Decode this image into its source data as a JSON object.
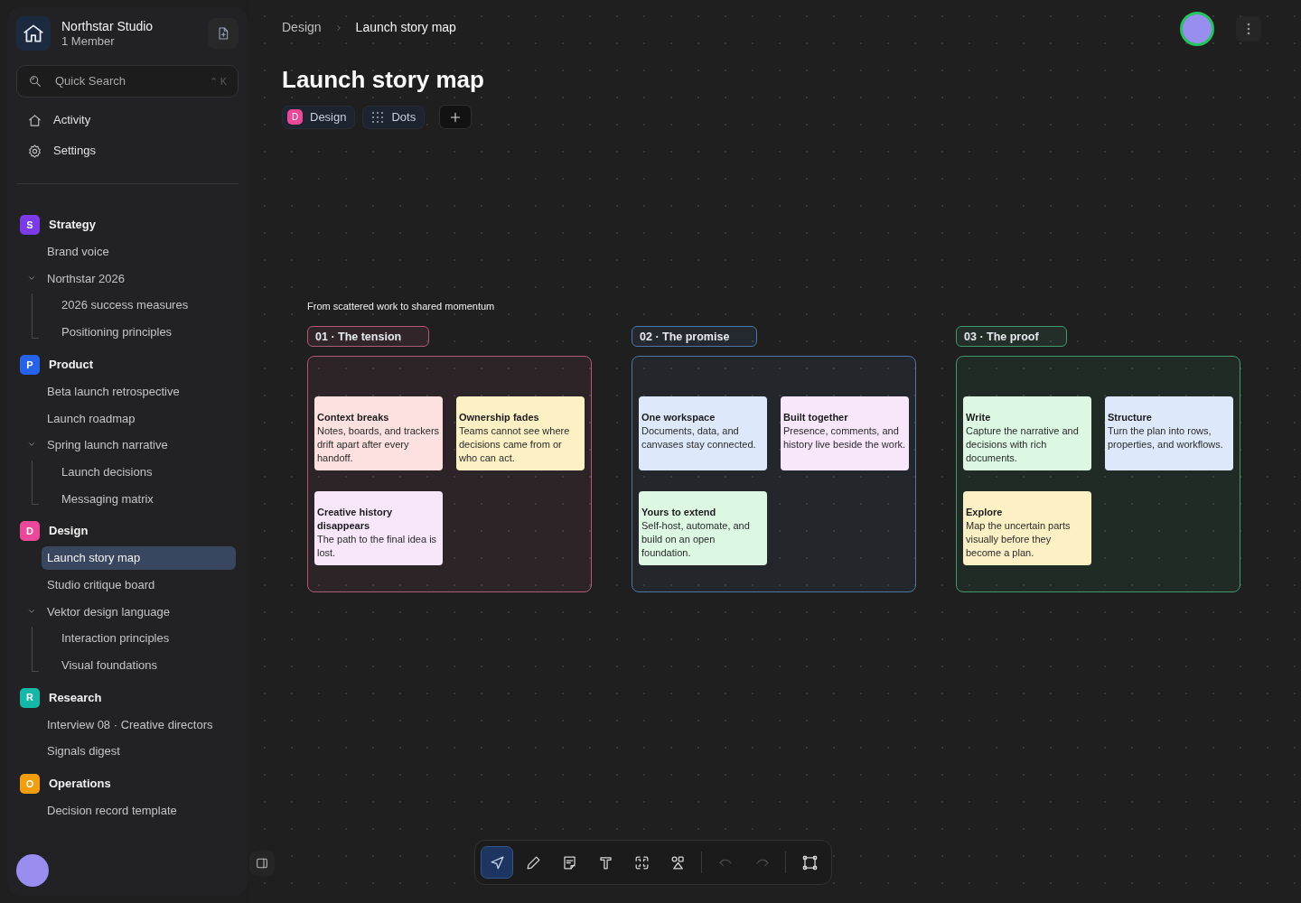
{
  "workspace": {
    "name": "Northstar Studio",
    "members": "1 Member"
  },
  "search": {
    "placeholder": "Quick Search",
    "shortcut": "⌃ K"
  },
  "nav": [
    {
      "kind": "activity",
      "label": "Activity"
    },
    {
      "kind": "settings",
      "label": "Settings"
    }
  ],
  "sections": [
    {
      "letter": "S",
      "name": "Strategy",
      "color": "#7c3aed",
      "items": [
        {
          "label": "Brand voice",
          "selected": false
        },
        {
          "label": "Northstar 2026",
          "selected": false,
          "expanded": true,
          "children": [
            {
              "label": "2026 success measures",
              "selected": false
            },
            {
              "label": "Positioning principles",
              "selected": false
            }
          ]
        }
      ]
    },
    {
      "letter": "P",
      "name": "Product",
      "color": "#2563eb",
      "items": [
        {
          "label": "Beta launch retrospective",
          "selected": false
        },
        {
          "label": "Launch roadmap",
          "selected": false
        },
        {
          "label": "Spring launch narrative",
          "selected": false,
          "expanded": true,
          "children": [
            {
              "label": "Launch decisions",
              "selected": false
            },
            {
              "label": "Messaging matrix",
              "selected": false
            }
          ]
        }
      ]
    },
    {
      "letter": "D",
      "name": "Design",
      "color": "#ec4899",
      "items": [
        {
          "label": "Launch story map",
          "selected": true
        },
        {
          "label": "Studio critique board",
          "selected": false
        },
        {
          "label": "Vektor design language",
          "selected": false,
          "expanded": true,
          "children": [
            {
              "label": "Interaction principles",
              "selected": false
            },
            {
              "label": "Visual foundations",
              "selected": false
            }
          ]
        }
      ]
    },
    {
      "letter": "R",
      "name": "Research",
      "color": "#14b8a6",
      "items": [
        {
          "label": "Interview 08 · Creative directors",
          "selected": false
        },
        {
          "label": "Signals digest",
          "selected": false
        }
      ]
    },
    {
      "letter": "O",
      "name": "Operations",
      "color": "#f59e0b",
      "items": [
        {
          "label": "Decision record template",
          "selected": false
        }
      ]
    }
  ],
  "breadcrumb": [
    "Design",
    "Launch story map"
  ],
  "page_title": "Launch story map",
  "tags": [
    {
      "kind": "space",
      "letter": "D",
      "label": "Design",
      "color": "#ec4899"
    },
    {
      "kind": "background",
      "label": "Dots"
    }
  ],
  "canvas": {
    "caption": "From scattered work to shared momentum",
    "frames": [
      {
        "label": "01 · The tension",
        "color": "#b05a7a",
        "notes": [
          {
            "title": "Context breaks",
            "text": "Notes, boards, and trackers drift apart after every handoff.",
            "color": "#fde0e0"
          },
          {
            "title": "Ownership fades",
            "text": "Teams cannot see where decisions came from or who can act.",
            "color": "#fdf0c4"
          },
          {
            "title": "Creative history disappears",
            "text": "The path to the final idea is lost.",
            "color": "#f8e6fb"
          }
        ]
      },
      {
        "label": "02 · The promise",
        "color": "#4a77a8",
        "notes": [
          {
            "title": "One workspace",
            "text": "Documents, data, and canvases stay connected.",
            "color": "#dde9fb"
          },
          {
            "title": "Built together",
            "text": "Presence, comments, and history live beside the work.",
            "color": "#f8e6fb"
          },
          {
            "title": "Yours to extend",
            "text": "Self-host, automate, and build on an open foundation.",
            "color": "#dcf8e3"
          }
        ]
      },
      {
        "label": "03 · The proof",
        "color": "#3f9a6e",
        "notes": [
          {
            "title": "Write",
            "text": "Capture the narrative and decisions with rich documents.",
            "color": "#dcf8e3"
          },
          {
            "title": "Structure",
            "text": "Turn the plan into rows, properties, and workflows.",
            "color": "#dde9fb"
          },
          {
            "title": "Explore",
            "text": "Map the uncertain parts visually before they become a plan.",
            "color": "#fdf0c4"
          }
        ]
      }
    ]
  },
  "toolbar": [
    {
      "kind": "select",
      "selected": true,
      "disabled": false
    },
    {
      "kind": "pen",
      "selected": false,
      "disabled": false
    },
    {
      "kind": "note",
      "selected": false,
      "disabled": false
    },
    {
      "kind": "text",
      "selected": false,
      "disabled": false
    },
    {
      "kind": "frame",
      "selected": false,
      "disabled": false
    },
    {
      "kind": "shapes",
      "selected": false,
      "disabled": false
    },
    {
      "kind": "undo",
      "selected": false,
      "disabled": true
    },
    {
      "kind": "redo",
      "selected": false,
      "disabled": true
    },
    {
      "kind": "fit",
      "selected": false,
      "disabled": false
    }
  ]
}
